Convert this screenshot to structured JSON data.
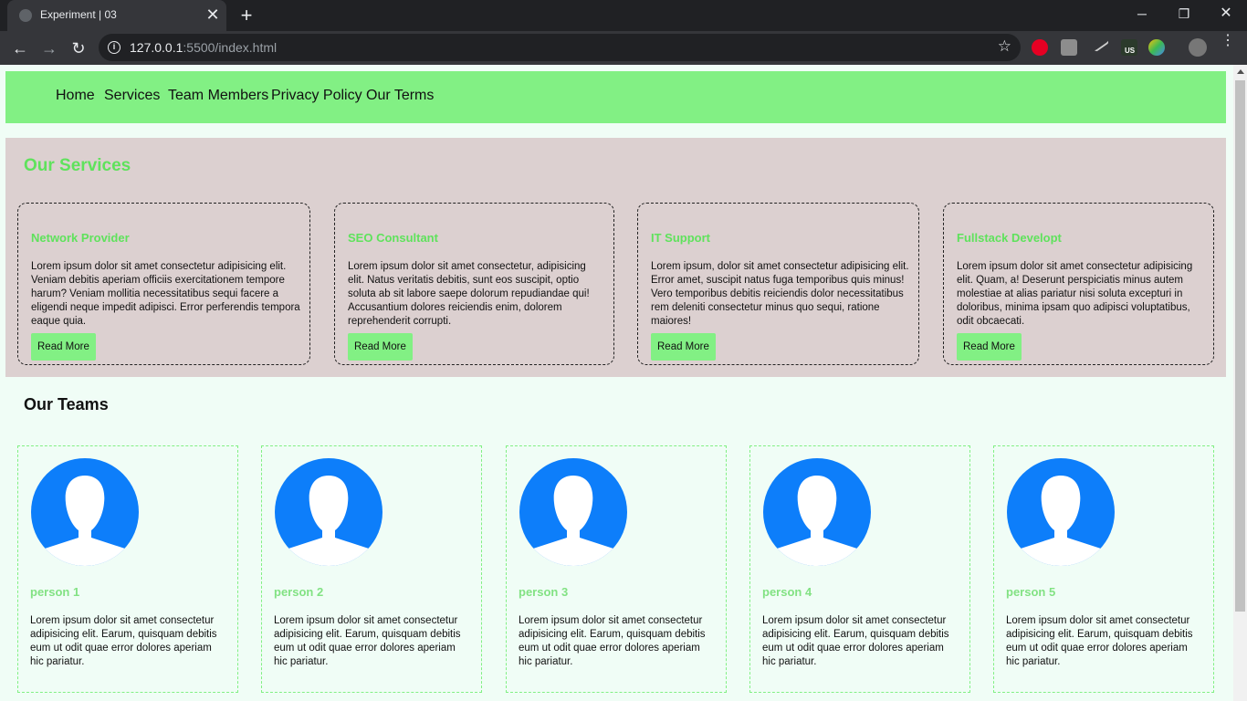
{
  "browser": {
    "tab_title": "Experiment | 03",
    "url_host": "127.0.0.1",
    "url_path": ":5500/index.html",
    "ext_badge": "US"
  },
  "nav": {
    "items": [
      "Home",
      "Services",
      "Team Members",
      "Privacy Policy",
      "Our Terms"
    ]
  },
  "services": {
    "heading": "Our Services",
    "cards": [
      {
        "title": "Network Provider",
        "text": "Lorem ipsum dolor sit amet consectetur adipisicing elit. Veniam debitis aperiam officiis exercitationem tempore harum? Veniam mollitia necessitatibus sequi facere a eligendi neque impedit adipisci. Error perferendis tempora eaque quia.",
        "button": "Read More"
      },
      {
        "title": "SEO Consultant",
        "text": "Lorem ipsum dolor sit amet consectetur, adipisicing elit. Natus veritatis debitis, sunt eos suscipit, optio soluta ab sit labore saepe dolorum repudiandae qui! Accusantium dolores reiciendis enim, dolorem reprehenderit corrupti.",
        "button": "Read More"
      },
      {
        "title": "IT Support",
        "text": "Lorem ipsum, dolor sit amet consectetur adipisicing elit. Error amet, suscipit natus fuga temporibus quis minus! Vero temporibus debitis reiciendis dolor necessitatibus rem deleniti consectetur minus quo sequi, ratione maiores!",
        "button": "Read More"
      },
      {
        "title": "Fullstack Developt",
        "text": "Lorem ipsum dolor sit amet consectetur adipisicing elit. Quam, a! Deserunt perspiciatis minus autem molestiae at alias pariatur nisi soluta excepturi in doloribus, minima ipsam quo adipisci voluptatibus, odit obcaecati.",
        "button": "Read More"
      }
    ]
  },
  "teams": {
    "heading": "Our Teams",
    "members": [
      {
        "name": "person 1",
        "text": "Lorem ipsum dolor sit amet consectetur adipisicing elit. Earum, quisquam debitis eum ut odit quae error dolores aperiam hic pariatur."
      },
      {
        "name": "person 2",
        "text": "Lorem ipsum dolor sit amet consectetur adipisicing elit. Earum, quisquam debitis eum ut odit quae error dolores aperiam hic pariatur."
      },
      {
        "name": "person 3",
        "text": "Lorem ipsum dolor sit amet consectetur adipisicing elit. Earum, quisquam debitis eum ut odit quae error dolores aperiam hic pariatur."
      },
      {
        "name": "person 4",
        "text": "Lorem ipsum dolor sit amet consectetur adipisicing elit. Earum, quisquam debitis eum ut odit quae error dolores aperiam hic pariatur."
      },
      {
        "name": "person 5",
        "text": "Lorem ipsum dolor sit amet consectetur adipisicing elit. Earum, quisquam debitis eum ut odit quae error dolores aperiam hic pariatur."
      }
    ]
  },
  "colors": {
    "nav_bg": "#82f084",
    "accent_green": "#5fe25c",
    "services_bg": "#dcd0d0",
    "page_bg": "#f0fdf6",
    "avatar_blue": "#0d7efa"
  },
  "icons": [
    "globe-icon",
    "close-icon",
    "plus-icon",
    "minimize-icon",
    "maximize-icon",
    "back-icon",
    "forward-icon",
    "reload-icon",
    "info-icon",
    "star-icon",
    "pinterest-icon",
    "facebook-icon",
    "pen-icon",
    "vpn-icon",
    "palette-icon",
    "profile-avatar-icon",
    "more-vert-icon",
    "user-avatar-icon"
  ]
}
